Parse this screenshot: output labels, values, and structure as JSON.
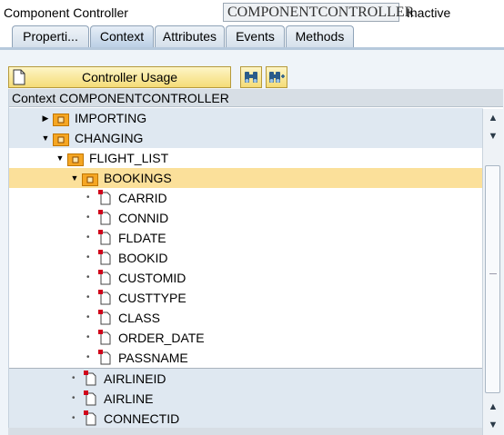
{
  "header": {
    "title": "Component Controller",
    "field_value": "COMPONENTCONTROLLER",
    "status": "Inactive"
  },
  "tabs": [
    {
      "label": "Properti...",
      "active": false
    },
    {
      "label": "Context",
      "active": true
    },
    {
      "label": "Attributes",
      "active": false
    },
    {
      "label": "Events",
      "active": false
    },
    {
      "label": "Methods",
      "active": false
    }
  ],
  "toolbar": {
    "controller_usage_label": "Controller Usage",
    "icons": [
      "binoculars-icon",
      "binoculars-add-icon"
    ]
  },
  "tree": {
    "header": "Context COMPONENTCONTROLLER",
    "rows": [
      {
        "label": "IMPORTING",
        "type": "folder",
        "state": "collapsed",
        "level": 1
      },
      {
        "label": "CHANGING",
        "type": "folder",
        "state": "expanded",
        "level": 1
      },
      {
        "label": "FLIGHT_LIST",
        "type": "folder",
        "state": "expanded",
        "level": 2
      },
      {
        "label": "BOOKINGS",
        "type": "folder",
        "state": "expanded",
        "level": 3,
        "selected": true
      },
      {
        "label": "CARRID",
        "type": "attribute",
        "level": 4
      },
      {
        "label": "CONNID",
        "type": "attribute",
        "level": 4
      },
      {
        "label": "FLDATE",
        "type": "attribute",
        "level": 4
      },
      {
        "label": "BOOKID",
        "type": "attribute",
        "level": 4
      },
      {
        "label": "CUSTOMID",
        "type": "attribute",
        "level": 4
      },
      {
        "label": "CUSTTYPE",
        "type": "attribute",
        "level": 4
      },
      {
        "label": "CLASS",
        "type": "attribute",
        "level": 4
      },
      {
        "label": "ORDER_DATE",
        "type": "attribute",
        "level": 4
      },
      {
        "label": "PASSNAME",
        "type": "attribute",
        "level": 4
      },
      {
        "label": "AIRLINEID",
        "type": "attribute",
        "level": 3
      },
      {
        "label": "AIRLINE",
        "type": "attribute",
        "level": 3
      },
      {
        "label": "CONNECTID",
        "type": "attribute",
        "level": 3
      }
    ]
  },
  "colors": {
    "folder": "#f5a623",
    "selected_row": "#fbe09a",
    "tab_active": "#bcd0e5",
    "button_yellow": "#f5dc77"
  }
}
